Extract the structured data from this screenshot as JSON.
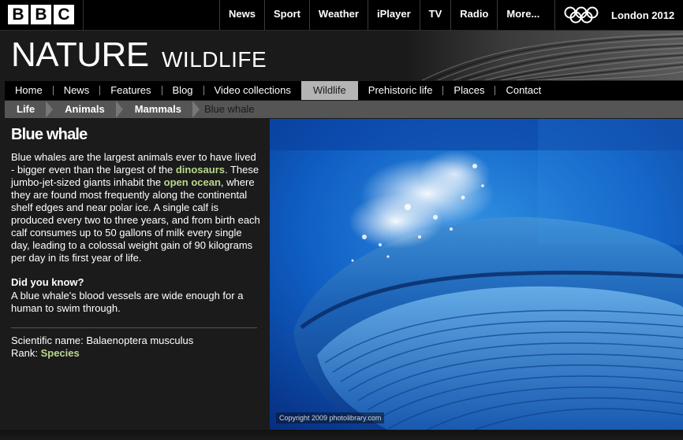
{
  "bbc": {
    "letters": [
      "B",
      "B",
      "C"
    ]
  },
  "global_nav": [
    "News",
    "Sport",
    "Weather",
    "iPlayer",
    "TV",
    "Radio",
    "More..."
  ],
  "olympics": {
    "label": "London 2012",
    "ring_colors": [
      "#ffffff"
    ]
  },
  "masthead": {
    "title": "NATURE",
    "subtitle": "WILDLIFE"
  },
  "section_nav": [
    "Home",
    "News",
    "Features",
    "Blog",
    "Video collections",
    "Wildlife",
    "Prehistoric life",
    "Places",
    "Contact"
  ],
  "section_nav_active": "Wildlife",
  "breadcrumb": [
    "Life",
    "Animals",
    "Mammals",
    "Blue whale"
  ],
  "article": {
    "heading": "Blue whale",
    "intro_1": "Blue whales are the largest animals ever to have lived - bigger even than the largest of the ",
    "link_dinosaurs": "dinosaurs",
    "intro_2": ". These jumbo-jet-sized giants inhabit the ",
    "link_open_ocean": "open ocean",
    "intro_3": ", where they are found most frequently along the continental shelf edges and near polar ice. A single calf is produced every two to three years, and from birth each calf consumes up to 50 gallons of milk every single day, leading to a colossal weight gain of 90 kilograms per day in its first year of life.",
    "did_you_know_title": "Did you know?",
    "did_you_know_text": "A blue whale's blood vessels are wide enough for a human to swim through.",
    "scientific_label": "Scientific name: Balaenoptera musculus",
    "rank_label": "Rank: ",
    "rank_value": "Species"
  },
  "photo": {
    "copyright": "Copyright 2009 photolibrary.com"
  },
  "colors": {
    "link": "#bbd88e",
    "active_tab": "#b4b4b4",
    "crumb_bg": "#555555",
    "ocean": "#0a3fa0"
  }
}
